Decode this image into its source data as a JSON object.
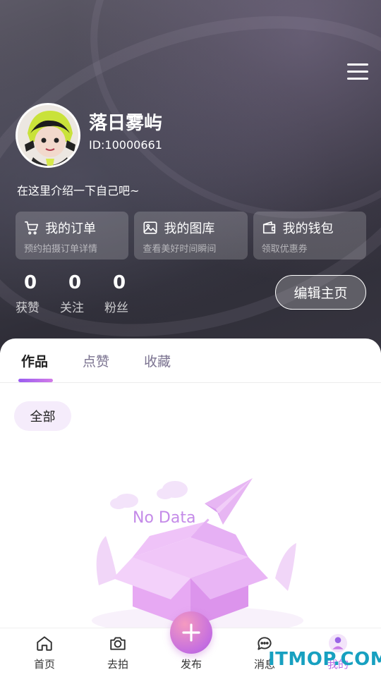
{
  "header": {
    "username": "落日雾屿",
    "user_id": "ID:10000661",
    "bio": "在这里介绍一下自己吧~",
    "cards": [
      {
        "title": "我的订单",
        "subtitle": "预约拍摄订单详情",
        "icon": "cart-icon"
      },
      {
        "title": "我的图库",
        "subtitle": "查看美好时间瞬间",
        "icon": "image-icon"
      },
      {
        "title": "我的钱包",
        "subtitle": "领取优惠券",
        "icon": "wallet-icon"
      }
    ],
    "stats": [
      {
        "value": "0",
        "label": "获赞"
      },
      {
        "value": "0",
        "label": "关注"
      },
      {
        "value": "0",
        "label": "粉丝"
      }
    ],
    "edit_label": "编辑主页"
  },
  "tabs": [
    {
      "label": "作品",
      "active": true
    },
    {
      "label": "点赞",
      "active": false
    },
    {
      "label": "收藏",
      "active": false
    }
  ],
  "filter_chip": "全部",
  "empty_state": {
    "text": "No Data"
  },
  "bottom_nav": [
    {
      "label": "首页",
      "icon": "home-icon"
    },
    {
      "label": "去拍",
      "icon": "camera-icon"
    },
    {
      "label": "发布",
      "icon": "plus-icon"
    },
    {
      "label": "消息",
      "icon": "chat-icon"
    },
    {
      "label": "我的",
      "icon": "user-icon"
    }
  ],
  "watermark": "ITMOP.COM",
  "colors": {
    "accent": "#b96de8",
    "chip_bg": "#f5ecfb",
    "watermark": "#17a0c0"
  }
}
